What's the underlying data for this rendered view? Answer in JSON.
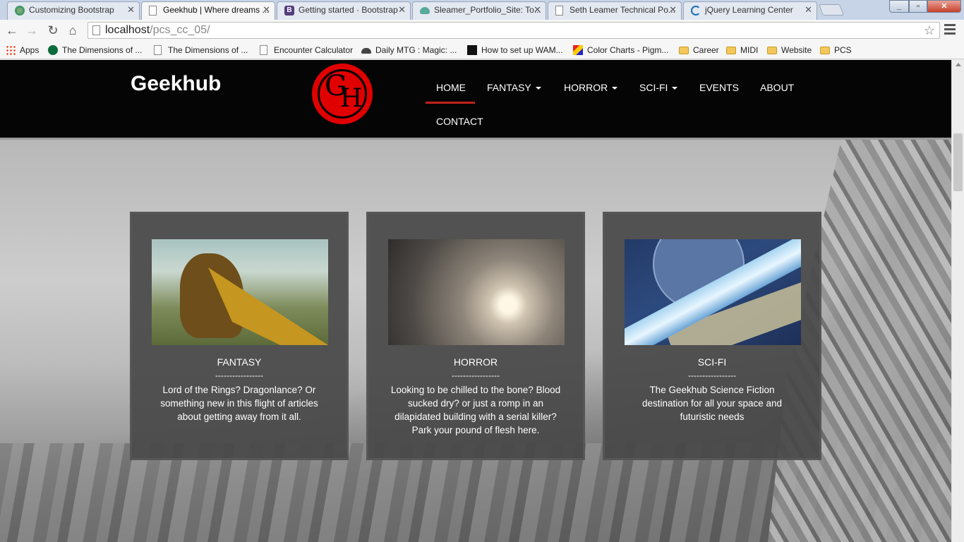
{
  "browser": {
    "tabs": [
      {
        "label": "Customizing Bootstrap",
        "icon": "gear-favicon-icon"
      },
      {
        "label": "Geekhub | Where dreams ...",
        "icon": "page-favicon-icon"
      },
      {
        "label": "Getting started · Bootstrap",
        "icon": "bootstrap-favicon-icon"
      },
      {
        "label": "Sleamer_Portfolio_Site: To...",
        "icon": "cloud-favicon-icon"
      },
      {
        "label": "Seth Leamer Technical Po...",
        "icon": "page-favicon-icon"
      },
      {
        "label": "jQuery Learning Center",
        "icon": "jquery-favicon-icon"
      }
    ],
    "url_host": "localhost",
    "url_path": "/pcs_cc_05/",
    "bookmarks": [
      {
        "label": "Apps",
        "icon": "apps-icon"
      },
      {
        "label": "The Dimensions of ...",
        "icon": "starbucks-icon"
      },
      {
        "label": "The Dimensions of ...",
        "icon": "page-icon"
      },
      {
        "label": "Encounter Calculator",
        "icon": "page-icon"
      },
      {
        "label": "Daily MTG : Magic: ...",
        "icon": "cap-icon"
      },
      {
        "label": "How to set up WAM...",
        "icon": "terminal-icon"
      },
      {
        "label": "Color Charts - Pigm...",
        "icon": "color-icon"
      },
      {
        "label": "Career",
        "icon": "folder-icon"
      },
      {
        "label": "MIDI",
        "icon": "folder-icon"
      },
      {
        "label": "Website",
        "icon": "folder-icon"
      },
      {
        "label": "PCS",
        "icon": "folder-icon"
      }
    ]
  },
  "site": {
    "brand": "Geekhub",
    "logo_letters": {
      "g": "G",
      "h": "H"
    },
    "nav": {
      "home": "HOME",
      "fantasy": "FANTASY",
      "horror": "HORROR",
      "scifi": "SCI-FI",
      "events": "EVENTS",
      "about": "ABOUT",
      "contact": "CONTACT"
    },
    "cards": [
      {
        "title": "FANTASY",
        "sep": "-----------------",
        "desc": "Lord of the Rings? Dragonlance? Or something new in this flight of articles about getting away from it all."
      },
      {
        "title": "HORROR",
        "sep": "-----------------",
        "desc": "Looking to be chilled to the bone? Blood sucked dry? or just a romp in an dilapidated building with a serial killer? Park your pound of flesh here."
      },
      {
        "title": "SCI-FI",
        "sep": "-----------------",
        "desc": "The Geekhub Science Fiction destination for all your space and futuristic needs"
      }
    ]
  },
  "colors": {
    "accent_red": "#e00000",
    "active_bar": "#c0221b",
    "navbar_bg": "#050505"
  }
}
